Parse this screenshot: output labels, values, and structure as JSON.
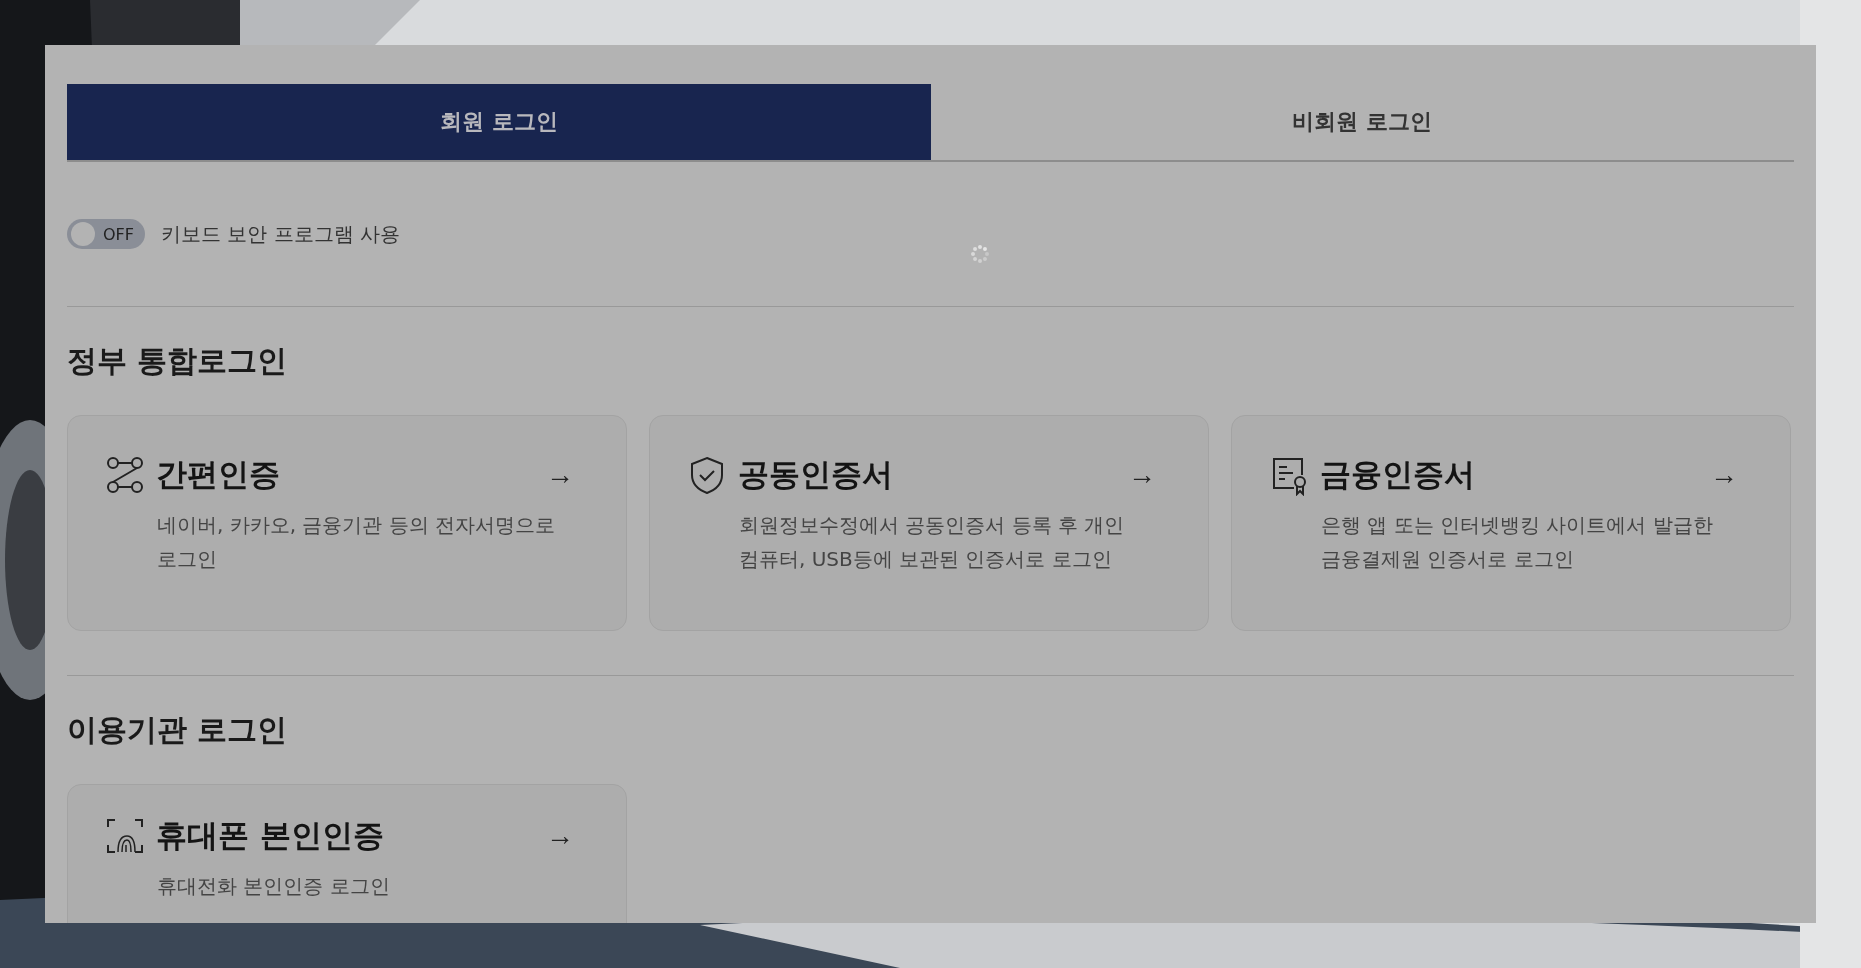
{
  "tabs": [
    {
      "label": "회원 로그인",
      "selected": true
    },
    {
      "label": "비회원 로그인",
      "selected": false
    }
  ],
  "keyboard_security": {
    "switch_text": "OFF",
    "on": false,
    "label": "키보드 보안 프로그램 사용"
  },
  "sections": [
    {
      "title": "정부 통합로그인",
      "cards": [
        {
          "kind": "nodes",
          "title": "간편인증",
          "arrow": "→",
          "description": "네이버, 카카오, 금융기관 등의 전자서명으로 로그인"
        },
        {
          "kind": "shield",
          "title": "공동인증서",
          "arrow": "→",
          "description": "회원정보수정에서 공동인증서 등록 후 개인 컴퓨터, USB등에 보관된 인증서로 로그인"
        },
        {
          "kind": "certificate",
          "title": "금융인증서",
          "arrow": "→",
          "description": "은행 앱 또는 인터넷뱅킹 사이트에서 발급한 금융결제원 인증서로 로그인"
        }
      ]
    },
    {
      "title": "이용기관 로그인",
      "cards": [
        {
          "kind": "fingerprint",
          "title": "휴대폰 본인인증",
          "arrow": "→",
          "description": "휴대전화 본인인증 로그인"
        }
      ]
    }
  ]
}
